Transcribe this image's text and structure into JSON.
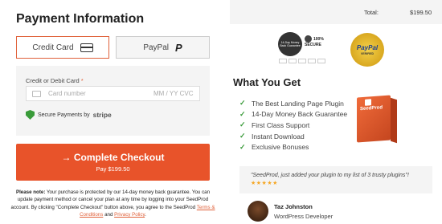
{
  "payment": {
    "title": "Payment Information",
    "tabs": [
      {
        "label": "Credit Card",
        "icon": "credit-card-icon",
        "selected": true
      },
      {
        "label": "PayPal",
        "icon": "paypal-icon",
        "selected": false
      }
    ],
    "card_label": "Credit or Debit Card",
    "required_mark": "*",
    "card_placeholder": "Card number",
    "expiry_placeholder": "MM / YY  CVC",
    "secure_text": "Secure Payments by",
    "secure_brand": "stripe",
    "checkout_label": "→ Complete Checkout",
    "checkout_sub": "Pay $199.50",
    "accent_color": "#e8532a"
  },
  "note": {
    "lead": "Please note:",
    "text1": " Your purchase is protected by our 14-day money back guarantee. You can update payment method or cancel your plan at any time by logging into your SeedProd account. By clicking \"Complete Checkout\" button above, you agree to the SeedProd ",
    "link1": "Terms & Conditions",
    "and": " and ",
    "link2": "Privacy Policy",
    "end": "."
  },
  "summary": {
    "total_label": "Total:",
    "total_value": "$199.50"
  },
  "badges": {
    "guarantee_text": "14-Day Money Back Guarantee",
    "secure_pct": "100%",
    "secure_word": "SECURE",
    "paypal_seal": "PayPal",
    "paypal_verified": "VERIFIED"
  },
  "what_you_get": {
    "title": "What You Get",
    "items": [
      "The Best Landing Page Plugin",
      "14-Day Money Back Guarantee",
      "First Class Support",
      "Instant Download",
      "Exclusive Bonuses"
    ],
    "product_name": "SeedProd"
  },
  "testimonial": {
    "quote": "\"SeedProd, just added your plugin to my list of 3 trusty plugins\"!",
    "stars": "★★★★★",
    "author": "Taz Johnston",
    "role": "WordPress Developer"
  }
}
